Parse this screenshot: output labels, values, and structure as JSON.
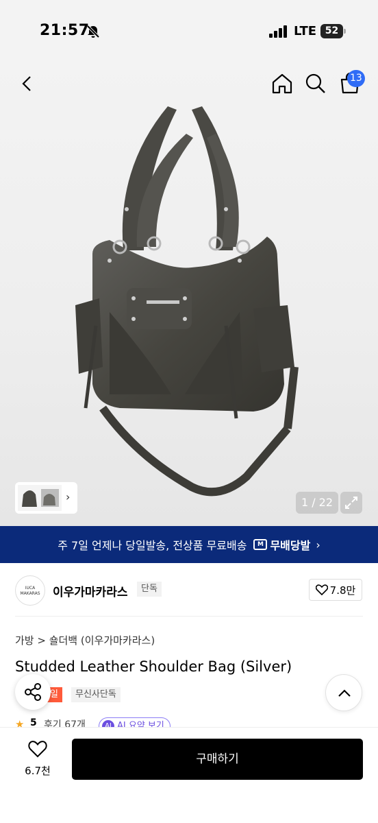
{
  "status_bar": {
    "time": "21:57",
    "network": "LTE",
    "battery": "52"
  },
  "header": {
    "cart_count": "13"
  },
  "gallery": {
    "counter": "1 / 22"
  },
  "promo": {
    "text": "주 7일 언제나 당일발송, 전상품 무료배송",
    "logo_label": "무배당발",
    "logo_mark": "M"
  },
  "brand": {
    "logo_line1": "IUCA",
    "logo_line2": "MAKARAS",
    "name": "이우가마카라스",
    "tag": "단독",
    "likes": "7.8만"
  },
  "product": {
    "breadcrumb": "가방 > 숄더백 (이우가마카라스)",
    "title": "Studded Leather Shoulder Bag (Silver)",
    "sale_tag": "세일",
    "exclusive_tag": "무신사단독",
    "rating": "5",
    "review_count": "후기 67개",
    "summary_chip": "AI 요약 보기",
    "summary_chip_mark": "AI"
  },
  "bottom_bar": {
    "likes": "6.7천",
    "buy_label": "구매하기"
  },
  "colors": {
    "promo_bg": "#0b2a7a",
    "badge": "#2f6cf6",
    "sale": "#ff5a3a",
    "star": "#f5a623",
    "buy_bg": "#000000"
  }
}
